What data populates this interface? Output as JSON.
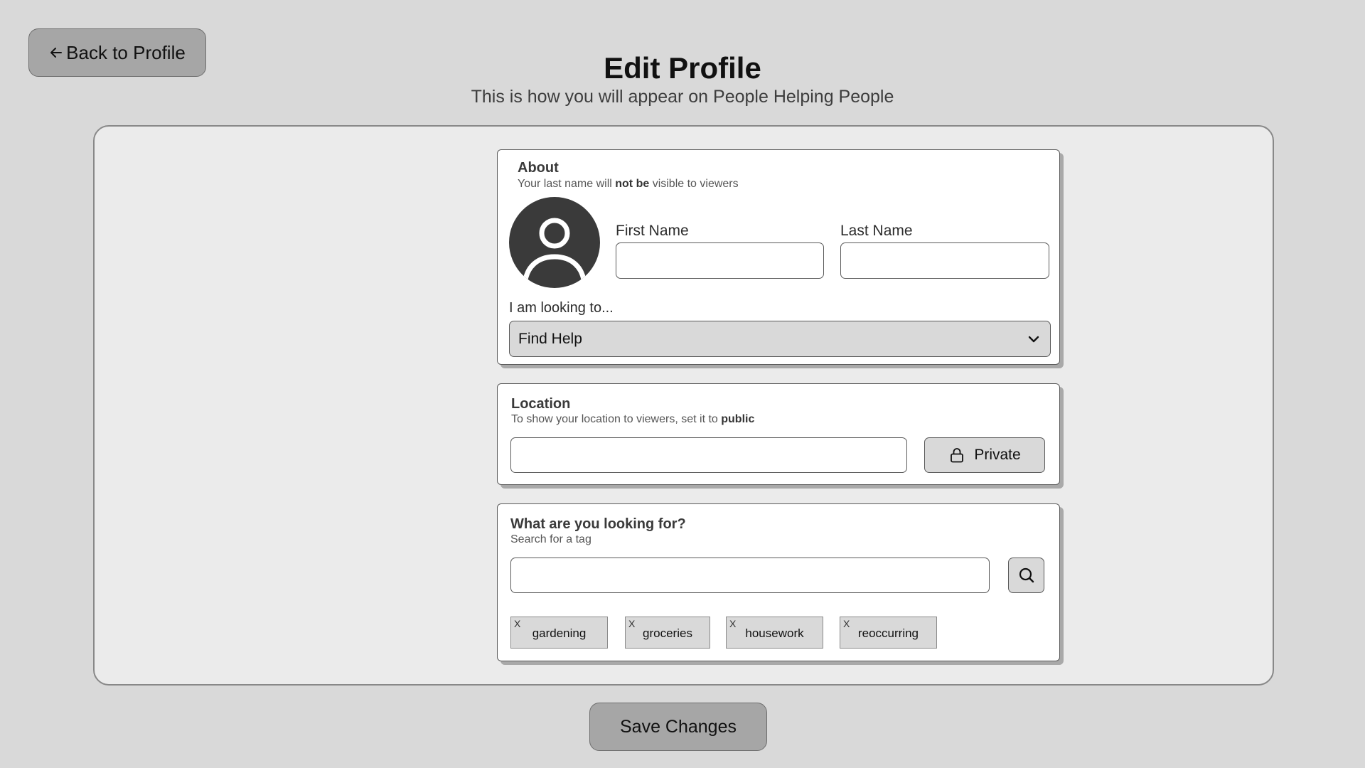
{
  "header": {
    "back_label": "Back to Profile",
    "title": "Edit Profile",
    "subtitle": "This is how you will appear on People Helping People"
  },
  "about": {
    "title": "About",
    "subtitle_prefix": "Your last name will ",
    "subtitle_bold": "not be",
    "subtitle_suffix": " visible to viewers",
    "first_name_label": "First Name",
    "first_name_value": "",
    "last_name_label": "Last Name",
    "last_name_value": "",
    "looking_label": "I am looking to...",
    "looking_selected": "Find Help"
  },
  "location": {
    "title": "Location",
    "subtitle_prefix": "To show your location to viewers, set it to ",
    "subtitle_bold": "public",
    "value": "",
    "privacy_label": "Private"
  },
  "tags": {
    "title": "What are you looking for?",
    "subtitle": "Search for a tag",
    "search_value": "",
    "remove_glyph": "X",
    "items": [
      "gardening",
      "groceries",
      "housework",
      "reoccurring"
    ]
  },
  "footer": {
    "save_label": "Save Changes"
  },
  "icons": {
    "back": "arrow-left-icon",
    "avatar": "user-avatar-icon",
    "dropdown": "chevron-down-icon",
    "privacy": "lock-icon",
    "search": "search-icon"
  },
  "colors": {
    "background": "#d9d9d9",
    "panel": "#ebebeb",
    "card": "#ffffff",
    "button": "#a6a6a6",
    "avatar": "#3a3a3a"
  }
}
